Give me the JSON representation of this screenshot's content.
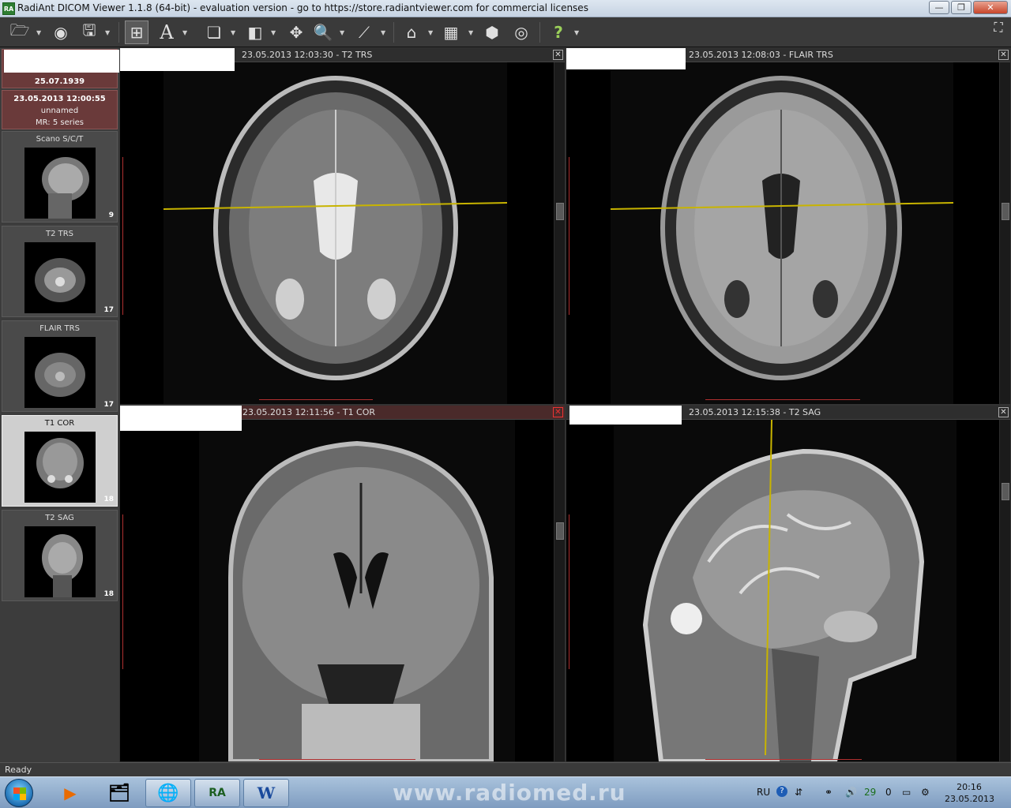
{
  "window": {
    "app_icon": "RA",
    "title": "RadiAnt DICOM Viewer 1.1.8 (64-bit) - evaluation version - go to https://store.radiantviewer.com for commercial licenses",
    "buttons": {
      "minimize": "—",
      "maximize": "❐",
      "close": "✕"
    }
  },
  "toolbar": {
    "tools": [
      {
        "name": "open-folder-icon",
        "glyph": "🗁"
      },
      {
        "name": "cd-dvd-icon",
        "glyph": "◉"
      },
      {
        "name": "save-icon",
        "glyph": "🖫"
      },
      {
        "name": "layout-icon",
        "glyph": "⊞"
      },
      {
        "name": "annotation-icon",
        "glyph": "A"
      },
      {
        "name": "series-icon",
        "glyph": "❏"
      },
      {
        "name": "window-level-icon",
        "glyph": "◧"
      },
      {
        "name": "pan-icon",
        "glyph": "✥"
      },
      {
        "name": "zoom-icon",
        "glyph": "🔍"
      },
      {
        "name": "measure-icon",
        "glyph": "⟋"
      },
      {
        "name": "3d-icon",
        "glyph": "⌂"
      },
      {
        "name": "cine-icon",
        "glyph": "▦"
      },
      {
        "name": "mpr-icon",
        "glyph": "⬢"
      },
      {
        "name": "fusion-icon",
        "glyph": "◎"
      },
      {
        "name": "help-icon",
        "glyph": "?"
      }
    ],
    "fullscreen_glyph": "⛶"
  },
  "sidebar": {
    "patient_dob": "25.07.1939",
    "study": {
      "datetime": "23.05.2013 12:00:55",
      "description": "unnamed",
      "summary": "MR: 5 series"
    },
    "series": [
      {
        "label": "Scano S/C/T",
        "count": "9"
      },
      {
        "label": "T2 TRS",
        "count": "17"
      },
      {
        "label": "FLAIR TRS",
        "count": "17"
      },
      {
        "label": "T1 COR",
        "count": "18"
      },
      {
        "label": "T2 SAG",
        "count": "18"
      }
    ]
  },
  "viewports": [
    {
      "title": "23.05.2013 12:03:30 - T2 TRS",
      "close": "✕"
    },
    {
      "title": "23.05.2013 12:08:03 - FLAIR TRS",
      "close": "✕"
    },
    {
      "title": "23.05.2013 12:11:56 - T1 COR",
      "close": "✕"
    },
    {
      "title": "23.05.2013 12:15:38 - T2 SAG",
      "close": "✕"
    }
  ],
  "status": {
    "text": "Ready"
  },
  "taskbar": {
    "watermark": "www.radiomed.ru",
    "apps": [
      {
        "name": "media-player",
        "glyph": "▶"
      },
      {
        "name": "explorer",
        "glyph": "🗂"
      },
      {
        "name": "firefox",
        "glyph": "🌐"
      },
      {
        "name": "radiant",
        "glyph": "RA"
      },
      {
        "name": "word",
        "glyph": "W"
      }
    ],
    "tray": {
      "lang": "RU",
      "help": "?",
      "num1": "29",
      "num2": "0"
    },
    "clock": {
      "time": "20:16",
      "date": "23.05.2013"
    }
  },
  "colors": {
    "active_header": "#4a2a2a",
    "reference_line": "#c8b400",
    "ruler": "#b03030"
  }
}
